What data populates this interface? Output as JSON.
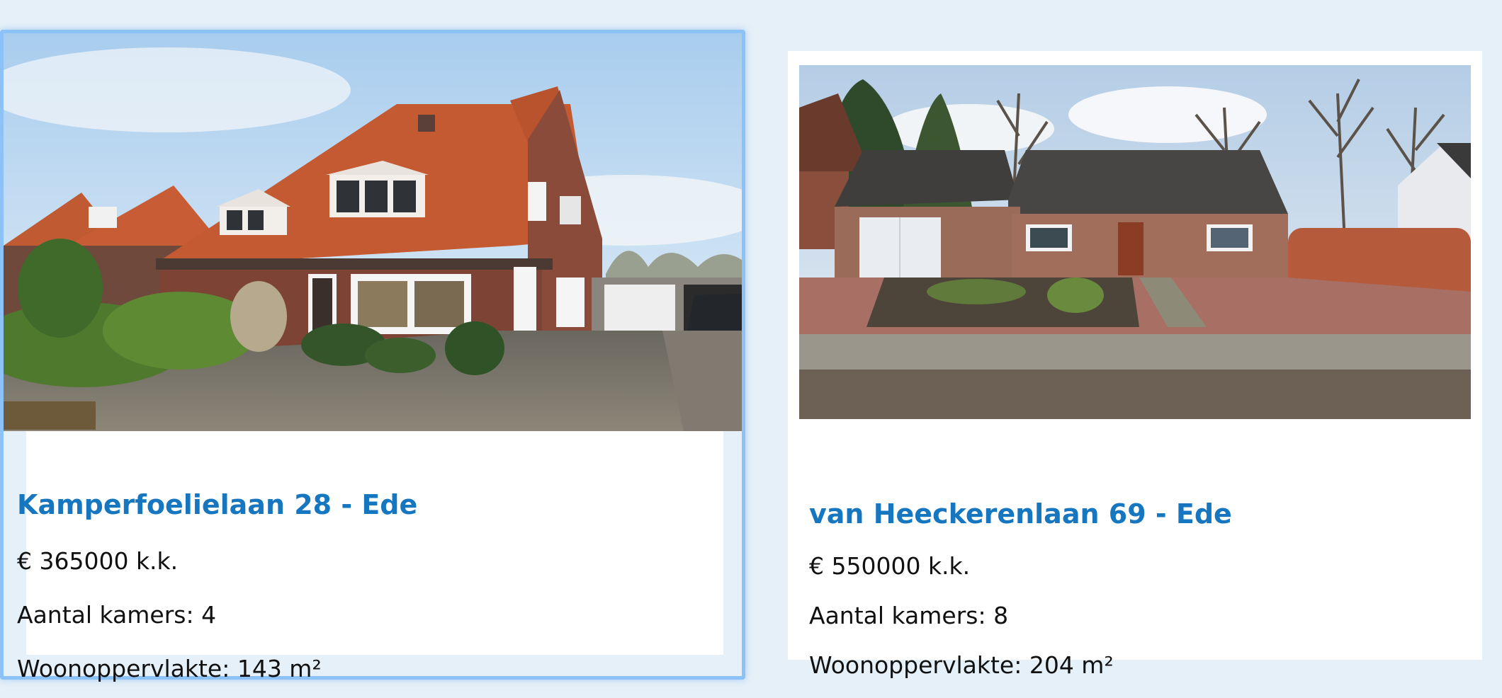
{
  "listings": [
    {
      "photo_alt": "Kamperfoelielaan 28 - Ede",
      "title": "Kamperfoelielaan 28 - Ede",
      "price": "€ 365000 k.k.",
      "rooms": "Aantal kamers: 4",
      "area": "Woonoppervlakte: 143 m²",
      "state": "hovered"
    },
    {
      "photo_alt": "van Heeckerenlaan 69 - Ede",
      "title": "van Heeckerenlaan 69 - Ede",
      "price": "€ 550000 k.k.",
      "rooms": "Aantal kamers: 8",
      "area": "Woonoppervlakte: 204 m²",
      "state": "default"
    }
  ],
  "colors": {
    "page_background": "#e6f0f8",
    "card_background": "#ffffff",
    "title_blue": "#1676bf",
    "hover_border": "#8cc2f7",
    "text": "#111111"
  }
}
